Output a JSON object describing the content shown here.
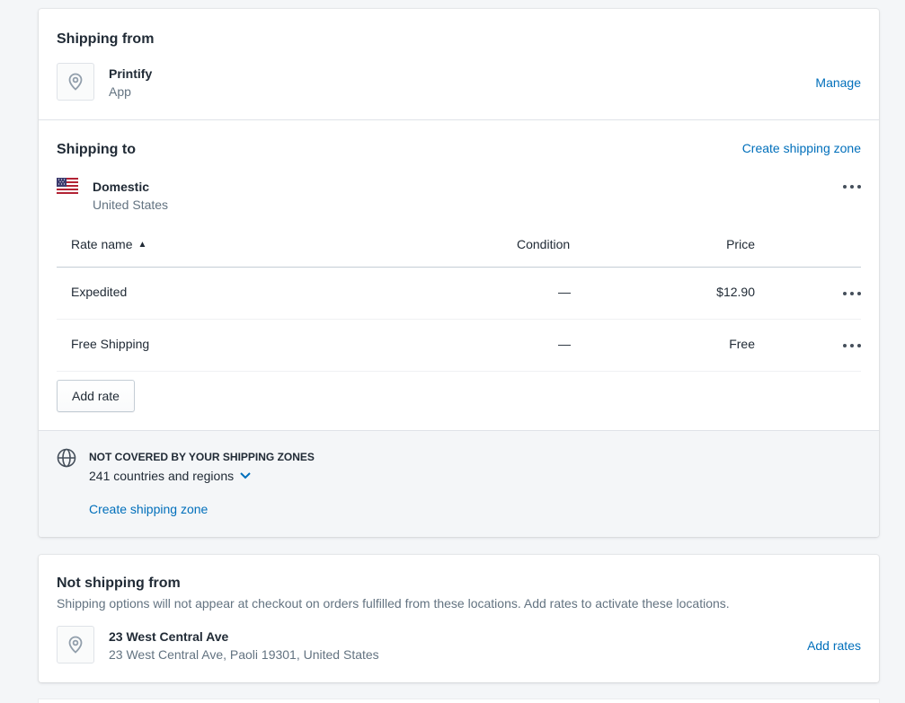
{
  "shipping_from": {
    "title": "Shipping from",
    "location_name": "Printify",
    "location_type": "App",
    "manage_link": "Manage"
  },
  "shipping_to": {
    "title": "Shipping to",
    "create_zone_link": "Create shipping zone",
    "zone": {
      "name": "Domestic",
      "countries": "United States",
      "flag": "us-flag-icon"
    },
    "table": {
      "headers": {
        "rate_name": "Rate name",
        "condition": "Condition",
        "price": "Price"
      },
      "sort_indicator": "▲",
      "rows": [
        {
          "name": "Expedited",
          "condition": "—",
          "price": "$12.90"
        },
        {
          "name": "Free Shipping",
          "condition": "—",
          "price": "Free"
        }
      ]
    },
    "add_rate_button": "Add rate"
  },
  "not_covered": {
    "heading": "NOT COVERED BY YOUR SHIPPING ZONES",
    "summary": "241 countries and regions",
    "icon": "globe-icon",
    "create_zone_link": "Create shipping zone"
  },
  "not_shipping_from": {
    "title": "Not shipping from",
    "description": "Shipping options will not appear at checkout on orders fulfilled from these locations. Add rates to activate these locations.",
    "location_name": "23 West Central Ave",
    "location_address": "23 West Central Ave, Paoli 19301, United States",
    "add_rates_link": "Add rates"
  },
  "colors": {
    "link": "#006fbb",
    "text": "#212b36",
    "subdued": "#637381",
    "background": "#f4f6f8"
  }
}
